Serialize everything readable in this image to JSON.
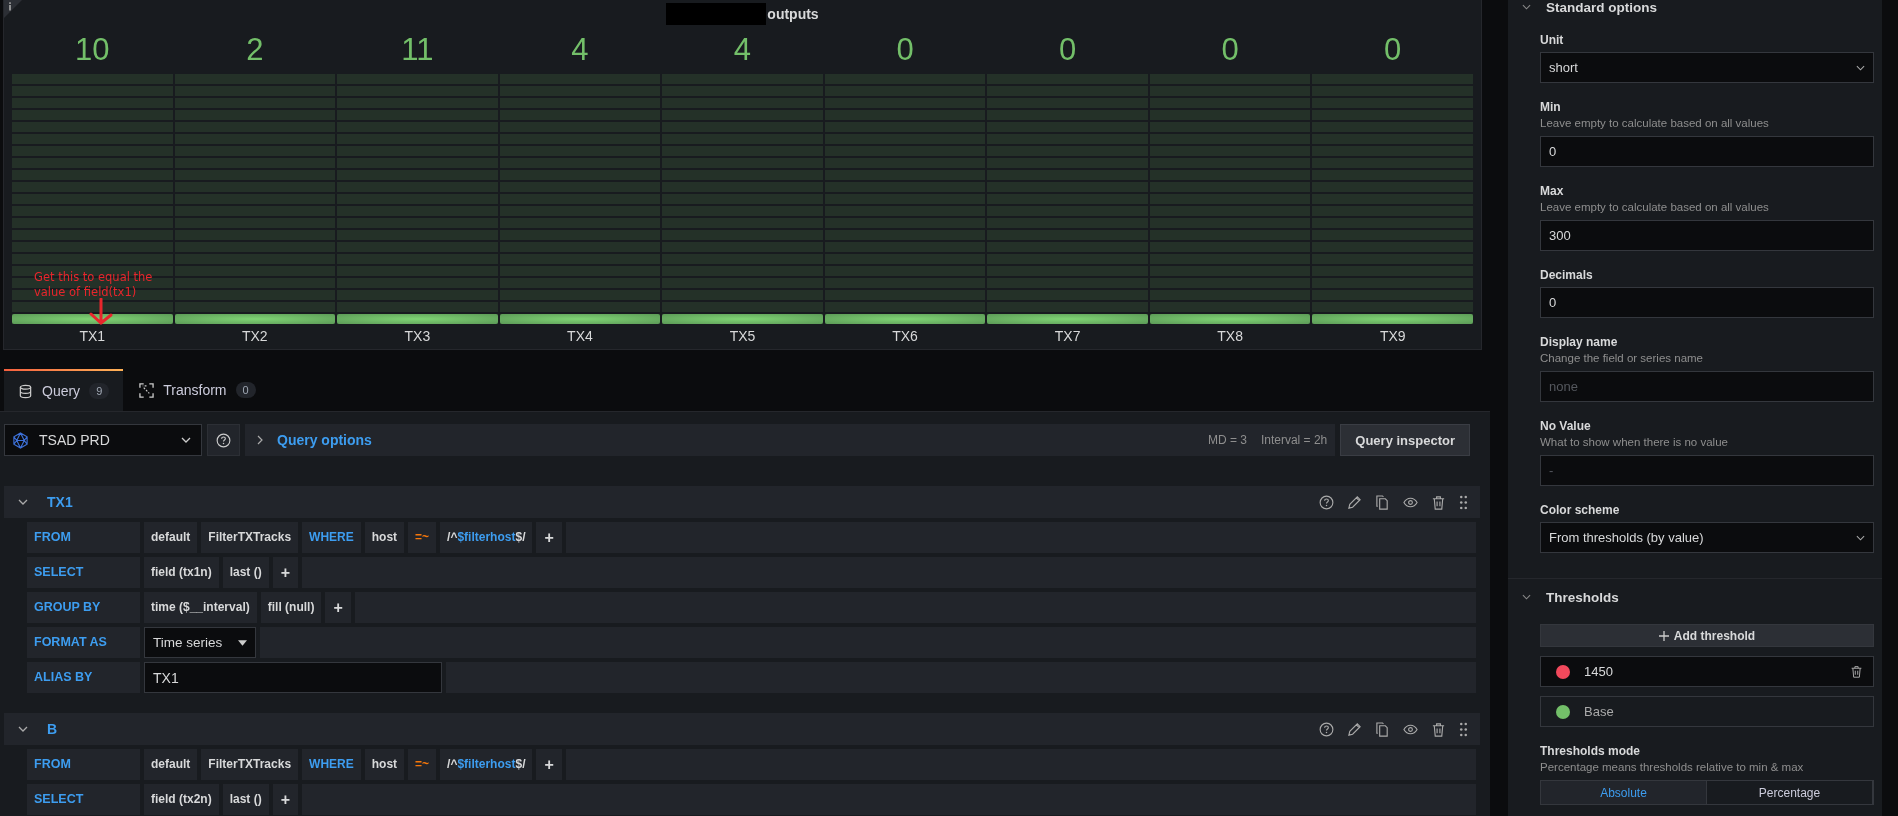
{
  "panel": {
    "title": "outputs",
    "annotation": "Get this to equal the value of field(tx1)",
    "gauges": [
      {
        "value": "10",
        "label": "TX1",
        "level": 0.05
      },
      {
        "value": "2",
        "label": "TX2",
        "level": 0.05
      },
      {
        "value": "11",
        "label": "TX3",
        "level": 0.05
      },
      {
        "value": "4",
        "label": "TX4",
        "level": 0.05
      },
      {
        "value": "4",
        "label": "TX5",
        "level": 0.05
      },
      {
        "value": "0",
        "label": "TX6",
        "level": 0.05
      },
      {
        "value": "0",
        "label": "TX7",
        "level": 0.05
      },
      {
        "value": "0",
        "label": "TX8",
        "level": 0.05
      },
      {
        "value": "0",
        "label": "TX9",
        "level": 0.05
      }
    ]
  },
  "editor_tabs": [
    {
      "label": "Query",
      "count": "9",
      "selected": true,
      "kind": "query"
    },
    {
      "label": "Transform",
      "count": "0",
      "selected": false,
      "kind": "transform"
    }
  ],
  "data_source": {
    "name": "TSAD PRD"
  },
  "query_options": {
    "label": "Query options",
    "md": "MD = 3",
    "interval": "Interval = 2h"
  },
  "query_inspector": "Query inspector",
  "queries": [
    {
      "name": "TX1",
      "expanded": true,
      "rows": [
        {
          "label": "FROM",
          "parts": [
            {
              "kind": "segment",
              "text": "default"
            },
            {
              "kind": "segment",
              "text": "FilterTXTracks"
            },
            {
              "kind": "keyword",
              "text": "WHERE"
            },
            {
              "kind": "segment",
              "text": "host"
            },
            {
              "kind": "operator",
              "text": "=~"
            },
            {
              "kind": "regex",
              "prefix": "/^",
              "variable": "$filterhost",
              "suffix": "$/"
            },
            {
              "kind": "add",
              "text": "+"
            }
          ]
        },
        {
          "label": "SELECT",
          "parts": [
            {
              "kind": "segment",
              "text": "field (tx1n)"
            },
            {
              "kind": "segment",
              "text": "last ()"
            },
            {
              "kind": "add",
              "text": "+"
            }
          ]
        },
        {
          "label": "GROUP BY",
          "parts": [
            {
              "kind": "segment",
              "text": "time ($__interval)"
            },
            {
              "kind": "segment",
              "text": "fill (null)"
            },
            {
              "kind": "add",
              "text": "+"
            }
          ]
        },
        {
          "label": "FORMAT AS",
          "parts": [
            {
              "kind": "select",
              "text": "Time series"
            }
          ]
        },
        {
          "label": "ALIAS BY",
          "parts": [
            {
              "kind": "input",
              "text": "TX1"
            }
          ]
        }
      ]
    },
    {
      "name": "B",
      "expanded": true,
      "rows": [
        {
          "label": "FROM",
          "parts": [
            {
              "kind": "segment",
              "text": "default"
            },
            {
              "kind": "segment",
              "text": "FilterTXTracks"
            },
            {
              "kind": "keyword",
              "text": "WHERE"
            },
            {
              "kind": "segment",
              "text": "host"
            },
            {
              "kind": "operator",
              "text": "=~"
            },
            {
              "kind": "regex",
              "prefix": "/^",
              "variable": "$filterhost",
              "suffix": "$/"
            },
            {
              "kind": "add",
              "text": "+"
            }
          ]
        },
        {
          "label": "SELECT",
          "parts": [
            {
              "kind": "segment",
              "text": "field (tx2n)"
            },
            {
              "kind": "segment",
              "text": "last ()"
            },
            {
              "kind": "add",
              "text": "+"
            }
          ]
        }
      ]
    }
  ],
  "options": {
    "title": "Standard options",
    "expanded": true,
    "fields": [
      {
        "kind": "select",
        "label": "Unit",
        "value": "short"
      },
      {
        "kind": "input",
        "label": "Min",
        "description": "Leave empty to calculate based on all values",
        "value": "0"
      },
      {
        "kind": "input",
        "label": "Max",
        "description": "Leave empty to calculate based on all values",
        "value": "300"
      },
      {
        "kind": "input",
        "label": "Decimals",
        "value": "0"
      },
      {
        "kind": "input",
        "label": "Display name",
        "description": "Change the field or series name",
        "placeholder": "none"
      },
      {
        "kind": "input",
        "label": "No Value",
        "description": "What to show when there is no value",
        "placeholder": "-"
      },
      {
        "kind": "select",
        "label": "Color scheme",
        "value": "From thresholds (by value)"
      }
    ]
  },
  "thresholds": {
    "title": "Thresholds",
    "expanded": true,
    "add_button": "Add threshold",
    "items": [
      {
        "value": "1450",
        "color": "#f2495c",
        "deletable": true
      },
      {
        "value": "Base",
        "color": "#73bf69",
        "deletable": false
      }
    ],
    "mode": {
      "label": "Thresholds mode",
      "description": "Percentage means thresholds relative to min & max",
      "options": [
        {
          "label": "Absolute",
          "selected": true
        },
        {
          "label": "Percentage",
          "selected": false
        }
      ]
    }
  }
}
